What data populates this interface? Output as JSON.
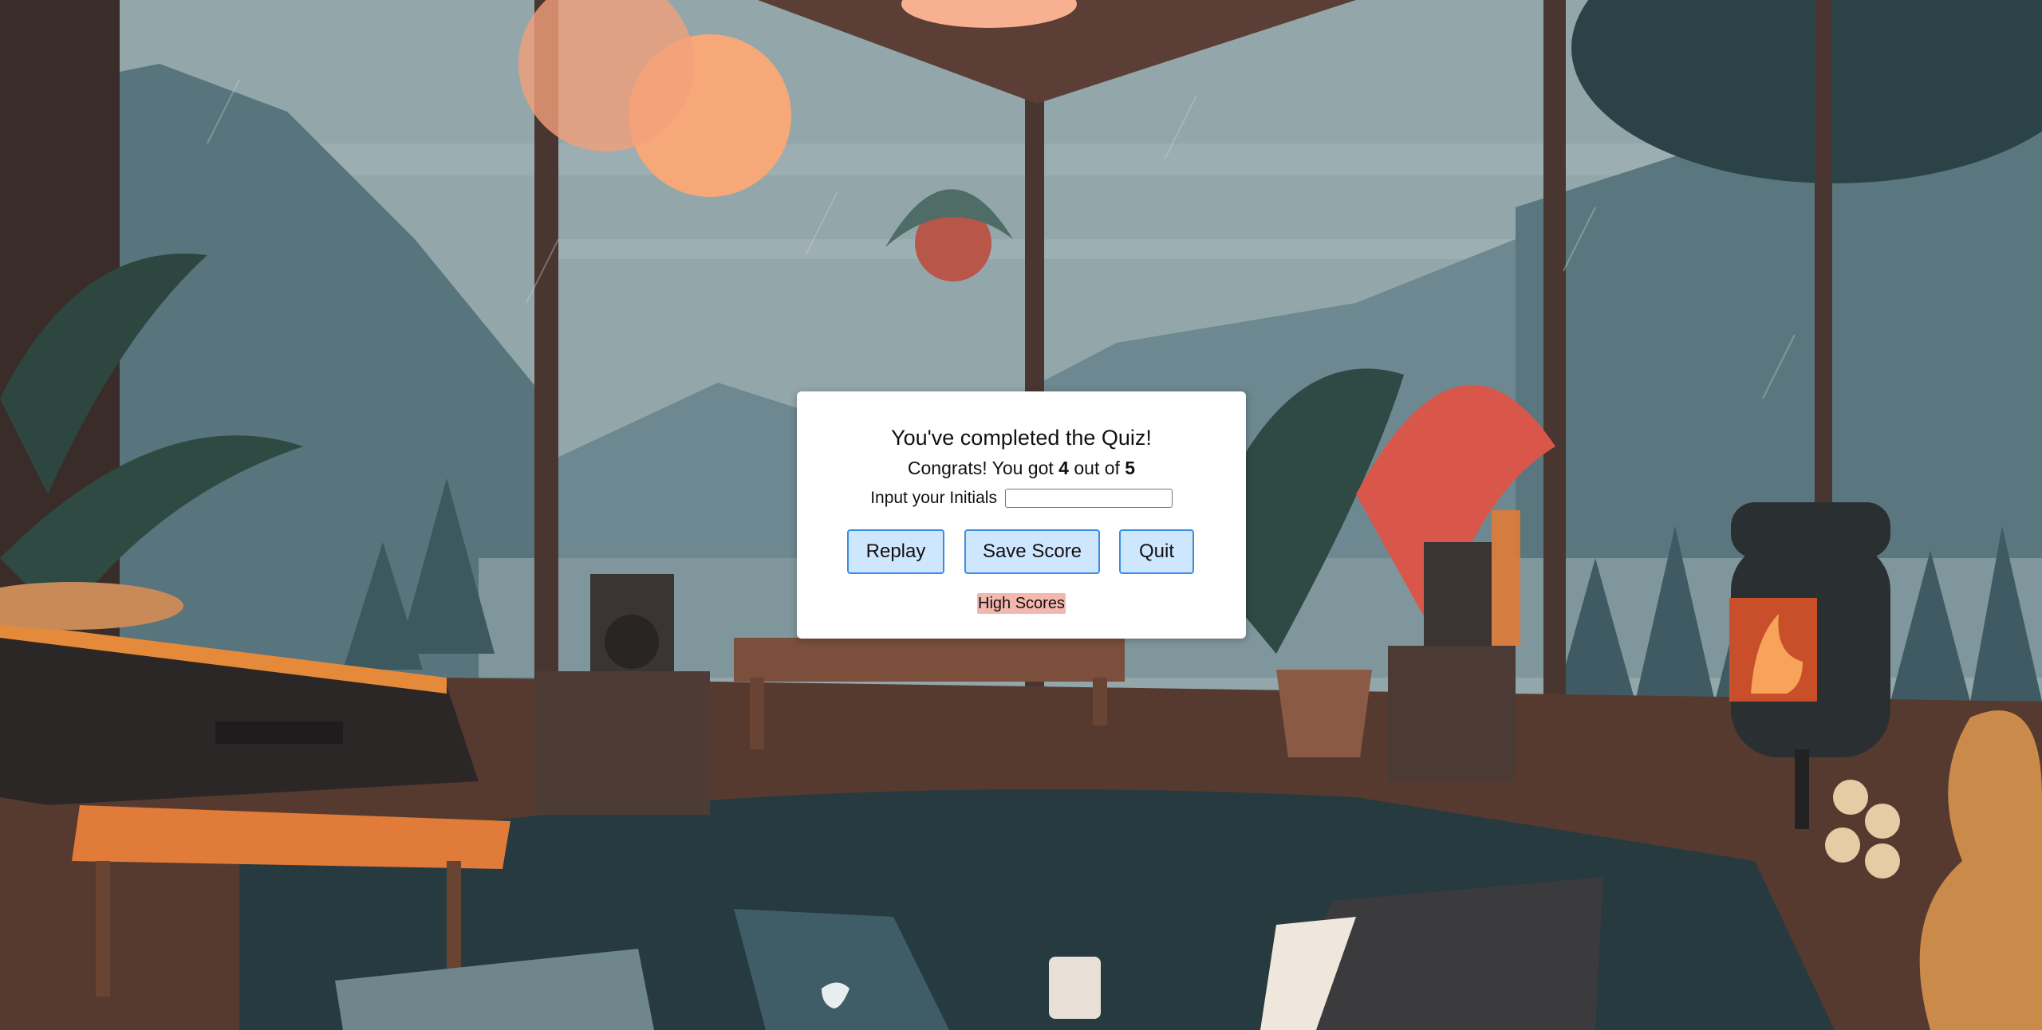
{
  "modal": {
    "title": "You've completed the Quiz!",
    "score_prefix": "Congrats! You got ",
    "score_value": "4",
    "score_middle": " out of ",
    "score_total": "5",
    "initials_label": "Input your Initials",
    "initials_value": "",
    "replay_label": "Replay",
    "save_label": "Save Score",
    "quit_label": "Quit",
    "high_scores_label": "High Scores"
  },
  "background": {
    "description_icon": "lofi-room-illustration",
    "colors": {
      "sky": "#8fa2a6",
      "mountain": "#5f7d86",
      "floor": "#5a3a2e",
      "rug": "#263a40",
      "lamp": "#f7a878",
      "accent_orange": "#e07b39",
      "button_fill": "#cfe6ff",
      "button_border": "#3b8de0",
      "link_highlight": "#f3b7ae"
    }
  }
}
